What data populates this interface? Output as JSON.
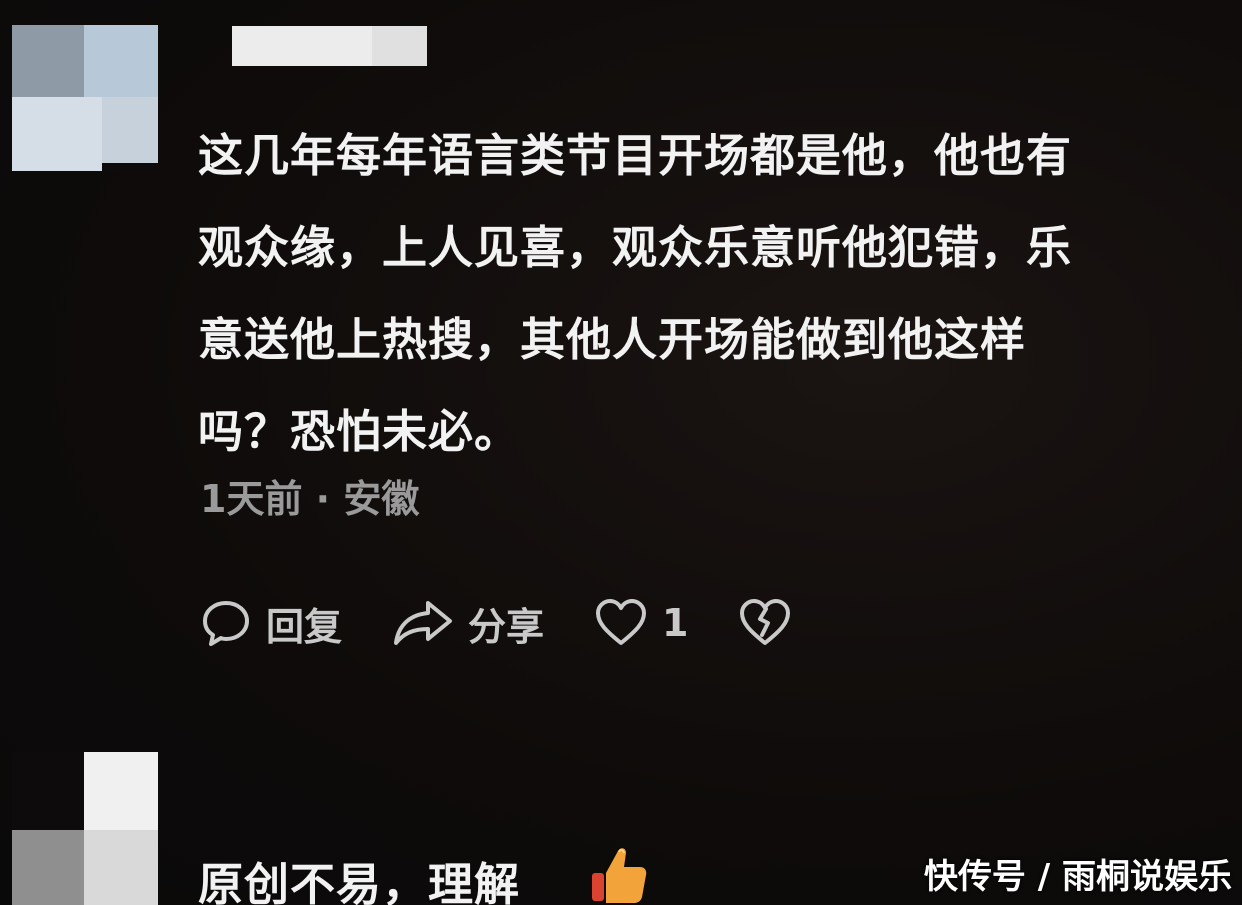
{
  "comments": [
    {
      "text_lines": [
        "这几年每年语言类节目开场都是他，他也有",
        "观众缘，上人见喜，观众乐意听他犯错，乐",
        "意送他上热搜，其他人开场能做到他这样",
        "吗？恐怕未必。"
      ],
      "meta": "1天前 · 安徽",
      "actions": {
        "reply_label": "回复",
        "share_label": "分享",
        "like_count": "1"
      }
    },
    {
      "text": "原创不易，理解"
    }
  ],
  "watermark": "快传号 / 雨桐说娱乐",
  "icons": {
    "reply": "comment-bubble-icon",
    "share": "share-arrow-icon",
    "like": "heart-icon",
    "dislike": "broken-heart-icon",
    "thumb": "thumbs-up-icon"
  },
  "colors": {
    "background": "#0d0b0b",
    "text": "#f2f2f2",
    "meta": "#9a9a9a",
    "action": "#c9c9c9",
    "thumb": "#f2a33a"
  }
}
